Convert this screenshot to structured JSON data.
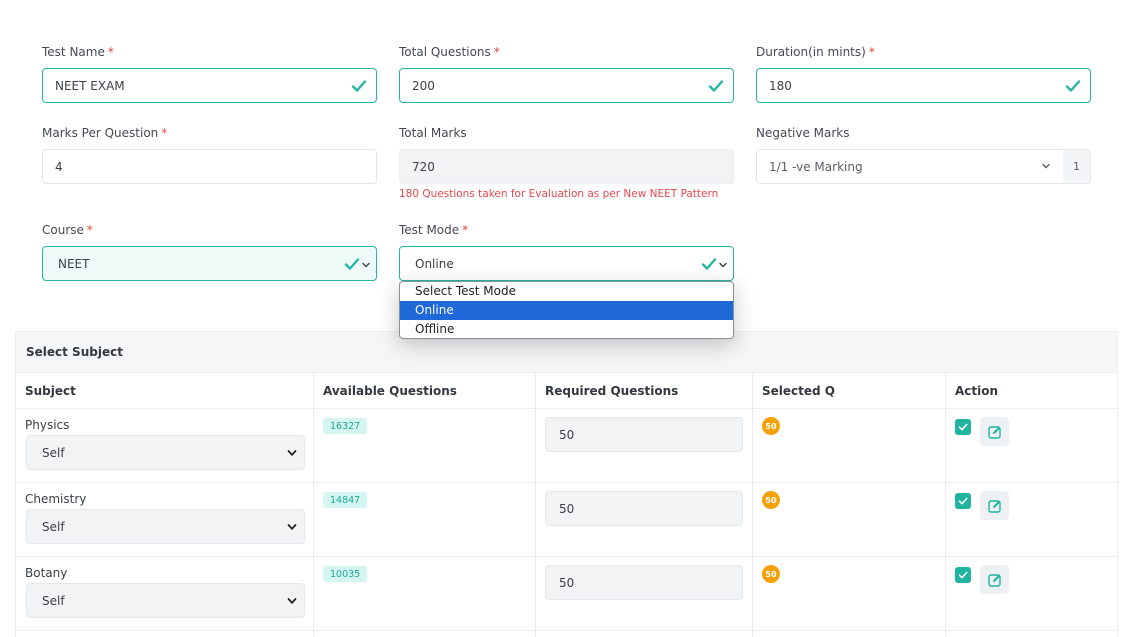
{
  "form": {
    "test_name": {
      "label": "Test Name",
      "required": "*",
      "value": "NEET EXAM"
    },
    "total_questions": {
      "label": "Total Questions",
      "required": "*",
      "value": "200"
    },
    "duration": {
      "label": "Duration(in mints)",
      "required": "*",
      "value": "180"
    },
    "marks_per_question": {
      "label": "Marks Per Question",
      "required": "*",
      "value": "4"
    },
    "total_marks": {
      "label": "Total Marks",
      "value": "720",
      "hint": "180 Questions taken for Evaluation as per New NEET Pattern"
    },
    "negative_marks": {
      "label": "Negative Marks",
      "selected": "1/1 -ve Marking",
      "value": "1"
    },
    "course": {
      "label": "Course",
      "required": "*",
      "selected": "NEET"
    },
    "test_mode": {
      "label": "Test Mode",
      "required": "*",
      "selected": "Online",
      "options": [
        "Select Test Mode",
        "Online",
        "Offline"
      ]
    }
  },
  "subjects": {
    "title": "Select Subject",
    "headers": [
      "Subject",
      "Available Questions",
      "Required Questions",
      "Selected Q",
      "Action"
    ],
    "rows": [
      {
        "name": "Physics",
        "source": "Self",
        "available": "16327",
        "required": "50",
        "selected": "50"
      },
      {
        "name": "Chemistry",
        "source": "Self",
        "available": "14847",
        "required": "50",
        "selected": "50"
      },
      {
        "name": "Botany",
        "source": "Self",
        "available": "10035",
        "required": "50",
        "selected": "50"
      }
    ]
  },
  "colors": {
    "accent": "#27b7a3",
    "error": "#e5484d",
    "badge": "#f5a20a",
    "selection": "#1e68d8"
  }
}
